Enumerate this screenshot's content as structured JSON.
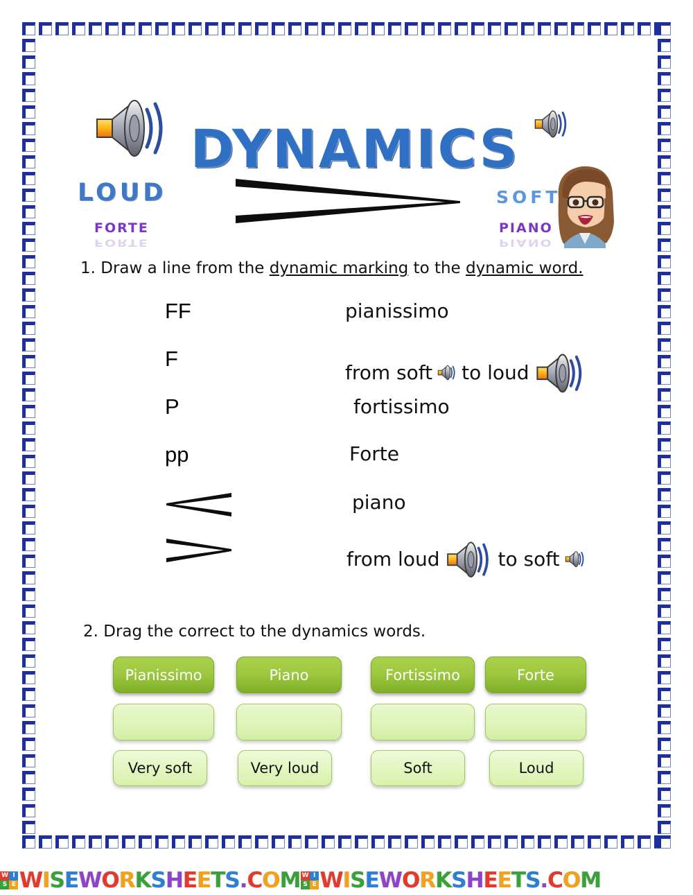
{
  "header": {
    "title": "DYNAMICS",
    "loud_label": "LOUD",
    "forte_label": "FORTE",
    "soft_label": "SOFT",
    "piano_label": "PIANO",
    "speaker_icon_left": "speaker-icon",
    "speaker_icon_right": "speaker-icon-small",
    "hairpin": "decrescendo-hairpin",
    "avatar": "teacher-avatar"
  },
  "exercise1": {
    "instruction_prefix": "1. Draw a line from the ",
    "instruction_underline_1": "dynamic marking",
    "instruction_middle": " to the ",
    "instruction_underline_2": "dynamic word.",
    "markings": [
      {
        "label": "FF",
        "type": "text"
      },
      {
        "label": "F",
        "type": "text"
      },
      {
        "label": "P",
        "type": "text"
      },
      {
        "label": "pp",
        "type": "text"
      },
      {
        "label": "crescendo-hairpin",
        "type": "hairpin-crescendo"
      },
      {
        "label": "decrescendo-hairpin",
        "type": "hairpin-decrescendo"
      }
    ],
    "words": [
      {
        "text": "pianissimo",
        "icons": []
      },
      {
        "text_before": "from soft",
        "text_after": "to loud",
        "icons": [
          "speaker-small",
          "speaker-large"
        ]
      },
      {
        "text": "fortissimo",
        "icons": []
      },
      {
        "text": "Forte",
        "icons": []
      },
      {
        "text": "piano",
        "icons": []
      },
      {
        "text_before": "from loud",
        "text_after": "to soft",
        "icons": [
          "speaker-large",
          "speaker-small"
        ]
      }
    ]
  },
  "exercise2": {
    "instruction": "2. Drag the correct to the dynamics words.",
    "terms": [
      "Pianissimo",
      "Piano",
      "Fortissimo",
      "Forte"
    ],
    "dropzones": [
      "",
      "",
      "",
      ""
    ],
    "answers": [
      "Very soft",
      "Very loud",
      "Soft",
      "Loud"
    ]
  },
  "footer": {
    "watermark_text": "WISEWORKSHEETS.COM",
    "badge_letters": [
      "W",
      "I",
      "S",
      "E"
    ],
    "repeat": 2
  },
  "colors": {
    "border": "#1c2f9c",
    "title": "#2f6fc4",
    "purple": "#7b35c9",
    "green_filled": "#9ec93f",
    "green_empty": "#ddf3b6"
  }
}
